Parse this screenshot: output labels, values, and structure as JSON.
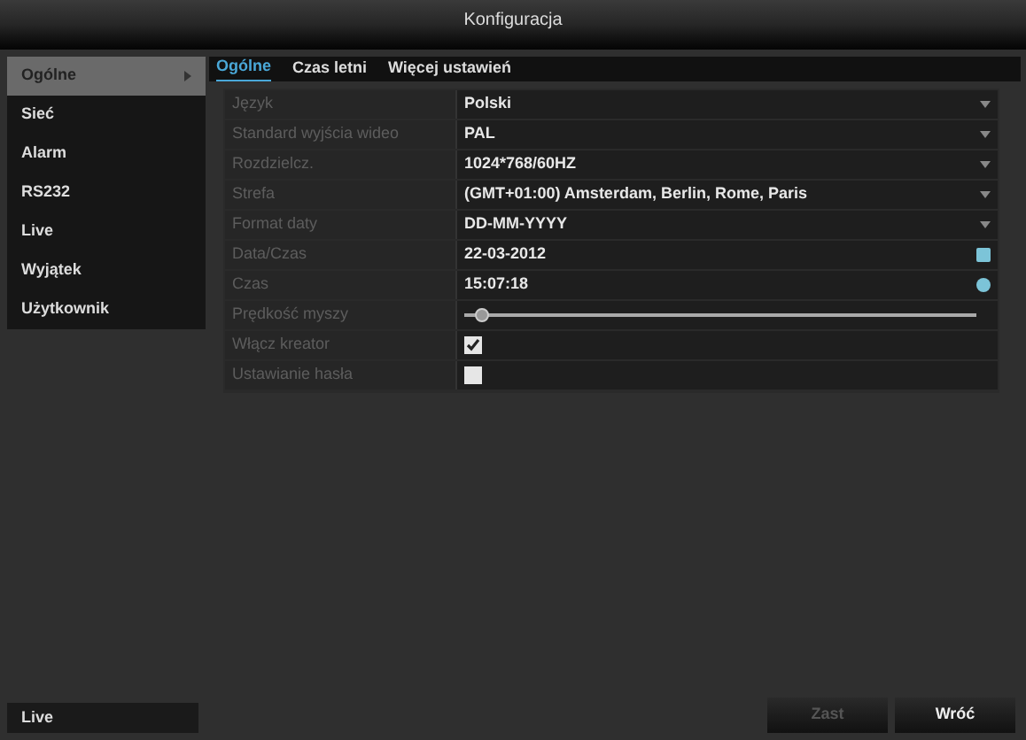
{
  "window": {
    "title": "Konfiguracja"
  },
  "sidebar": {
    "items": [
      {
        "label": "Ogólne",
        "selected": true
      },
      {
        "label": "Sieć",
        "selected": false
      },
      {
        "label": "Alarm",
        "selected": false
      },
      {
        "label": "RS232",
        "selected": false
      },
      {
        "label": "Live",
        "selected": false
      },
      {
        "label": "Wyjątek",
        "selected": false
      },
      {
        "label": "Użytkownik",
        "selected": false
      }
    ],
    "footer_button": "Live"
  },
  "tabs": [
    {
      "label": "Ogólne",
      "selected": true
    },
    {
      "label": "Czas letni",
      "selected": false
    },
    {
      "label": "Więcej ustawień",
      "selected": false
    }
  ],
  "settings": [
    {
      "kind": "select",
      "label": "Język",
      "value": "Polski"
    },
    {
      "kind": "select",
      "label": "Standard wyjścia wideo",
      "value": "PAL"
    },
    {
      "kind": "select",
      "label": "Rozdzielcz.",
      "value": "1024*768/60HZ"
    },
    {
      "kind": "select",
      "label": "Strefa",
      "value": "(GMT+01:00) Amsterdam, Berlin, Rome, Paris"
    },
    {
      "kind": "select",
      "label": "Format daty",
      "value": "DD-MM-YYYY"
    },
    {
      "kind": "date",
      "label": "Data/Czas",
      "value": "22-03-2012"
    },
    {
      "kind": "time",
      "label": "Czas",
      "value": "15:07:18"
    },
    {
      "kind": "slider",
      "label": "Prędkość myszy",
      "level": 0.02
    },
    {
      "kind": "checkbox",
      "label": "Włącz kreator",
      "checked": true
    },
    {
      "kind": "checkbox",
      "label": "Ustawianie hasła",
      "checked": false
    }
  ],
  "buttons": [
    {
      "label": "Zast",
      "disabled": true
    },
    {
      "label": "Wróć",
      "disabled": false
    }
  ]
}
